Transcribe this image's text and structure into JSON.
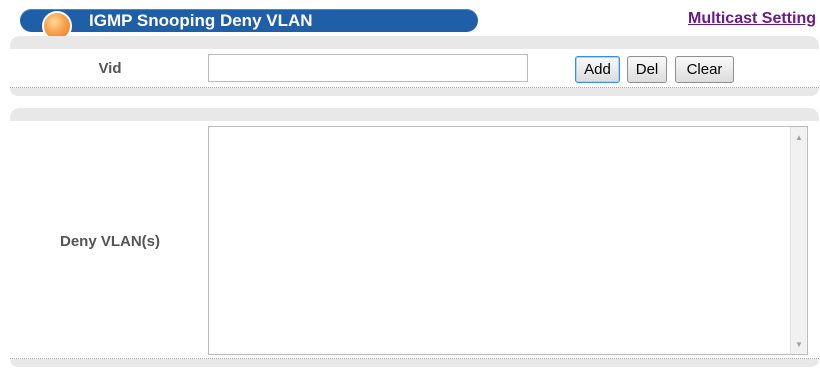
{
  "header": {
    "title": "IGMP Snooping Deny VLAN",
    "multicast_link": "Multicast Setting"
  },
  "vid_row": {
    "label": "Vid",
    "input_value": "",
    "buttons": {
      "add": "Add",
      "del": "Del",
      "clear": "Clear"
    }
  },
  "deny_row": {
    "label": "Deny VLAN(s)",
    "items": []
  },
  "icons": {
    "scroll_up": "triangle-up",
    "scroll_down": "triangle-down"
  },
  "colors": {
    "title_bar": "#1f5fa8",
    "link": "#6a1b8a",
    "panel": "#e8e8e8"
  }
}
